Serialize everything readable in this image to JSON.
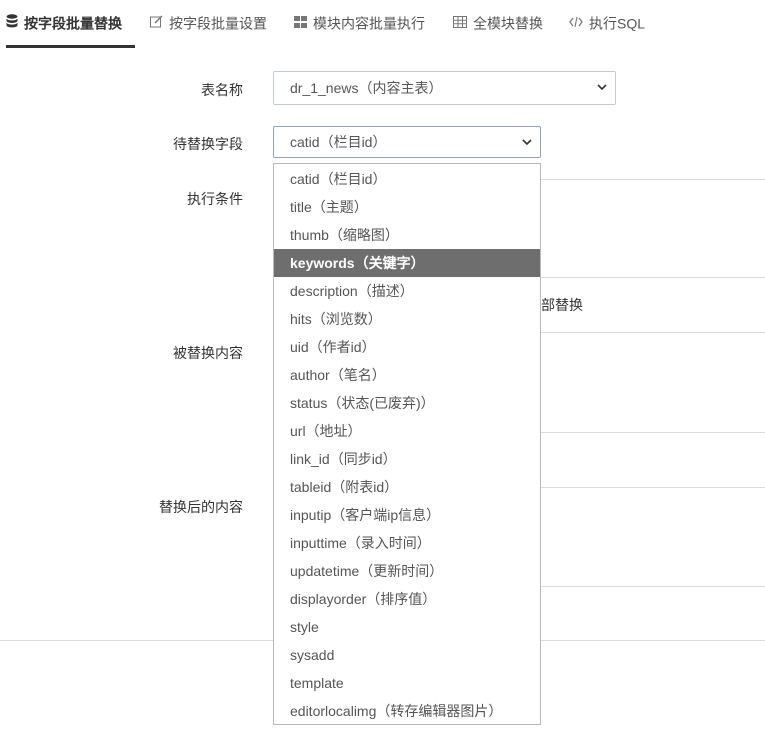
{
  "tabs": [
    {
      "label": "按字段批量替换",
      "icon": "database-icon"
    },
    {
      "label": "按字段批量设置",
      "icon": "edit-icon"
    },
    {
      "label": "模块内容批量执行",
      "icon": "grid-icon"
    },
    {
      "label": "全模块替换",
      "icon": "table-icon"
    },
    {
      "label": "执行SQL",
      "icon": "code-icon"
    }
  ],
  "form": {
    "table_label": "表名称",
    "table_value": "dr_1_news（内容主表）",
    "field_label": "待替换字段",
    "field_value": "catid（栏目id）",
    "condition_label": "执行条件",
    "replace_all_partial": "部替换",
    "replaced_label": "被替换内容",
    "after_label": "替换后的内容"
  },
  "dropdown": {
    "options": [
      "catid（栏目id）",
      "title（主题）",
      "thumb（缩略图）",
      "keywords（关键字）",
      "description（描述）",
      "hits（浏览数）",
      "uid（作者id）",
      "author（笔名）",
      "status（状态(已废弃)）",
      "url（地址）",
      "link_id（同步id）",
      "tableid（附表id）",
      "inputip（客户端ip信息）",
      "inputtime（录入时间）",
      "updatetime（更新时间）",
      "displayorder（排序值）",
      "style",
      "sysadd",
      "template",
      "editorlocalimg（转存编辑器图片）"
    ],
    "highlighted_index": 3
  }
}
